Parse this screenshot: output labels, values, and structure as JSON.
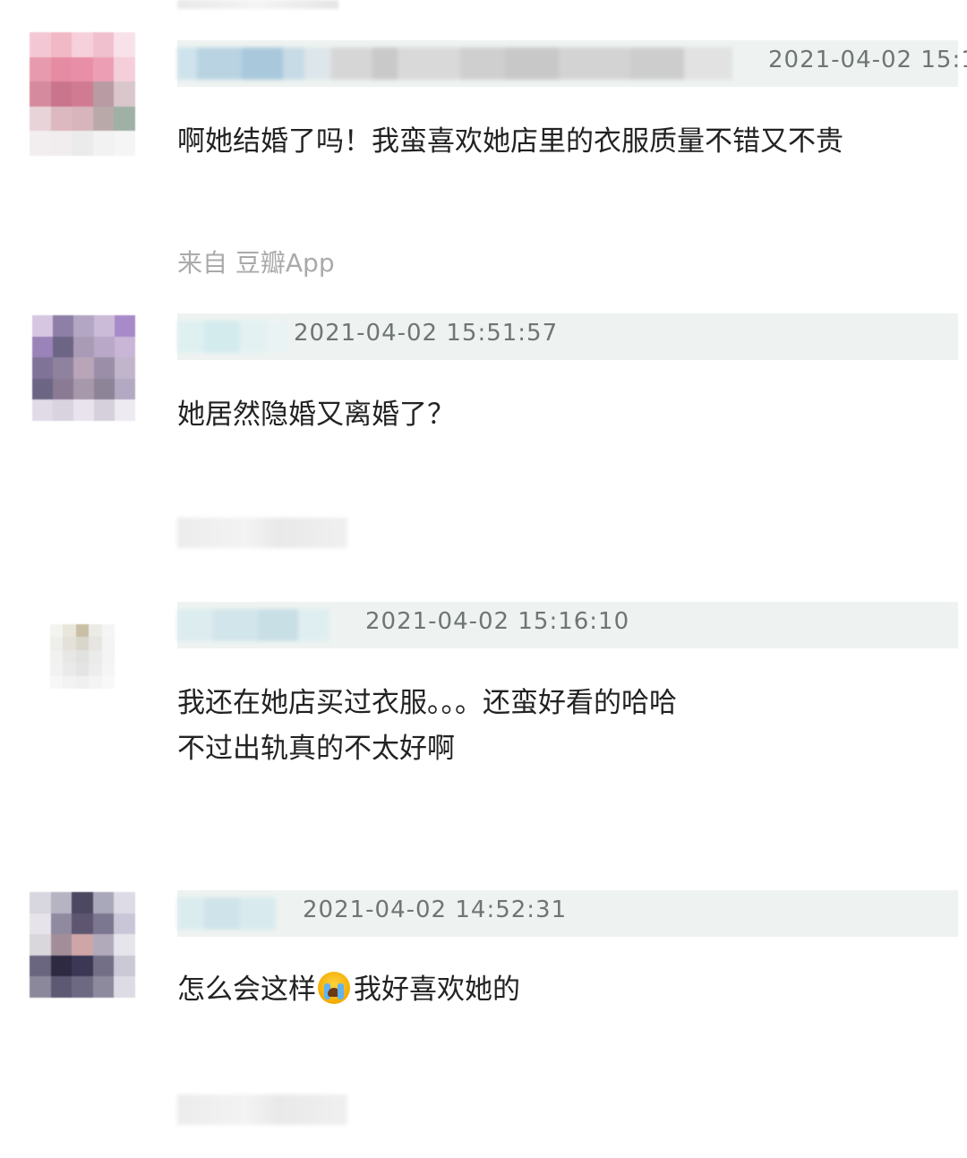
{
  "comments": [
    {
      "timestamp": "2021-04-02 15:1",
      "text": "啊她结婚了吗！我蛮喜欢她店里的衣服质量不错又不贵",
      "source": "来自 豆瓣App",
      "avatar_colors": [
        "#f3c8d4",
        "#f1b8c6",
        "#f6d0da",
        "#f0c0cf",
        "#f8e1e8",
        "#e79aae",
        "#e58ca3",
        "#e88ea7",
        "#ec9fb4",
        "#f4cfd9",
        "#d68a9d",
        "#c8758d",
        "#d17b93",
        "#b89ba3",
        "#d9c7cb",
        "#e7d3d8",
        "#dcb8c0",
        "#d8b4bc",
        "#b9a9a8",
        "#9fb1a5",
        "#f2eef0",
        "#f1ecee",
        "#ecebeb",
        "#f2f2f2",
        "#f5f5f5"
      ]
    },
    {
      "timestamp": "2021-04-02 15:51:57",
      "text": "她居然隐婚又离婚了？",
      "avatar_colors": [
        "#d6c6e2",
        "#8d7fa5",
        "#b3a6c4",
        "#cbbad8",
        "#a88ac9",
        "#9a83b8",
        "#6d6584",
        "#a99bb6",
        "#b9a8c7",
        "#c9b6d6",
        "#7f7398",
        "#8f829f",
        "#b8a6b8",
        "#9b8ea8",
        "#c1b5cc",
        "#6c6584",
        "#8b7a94",
        "#a798ab",
        "#8d8497",
        "#b3a9c2",
        "#e1dbe8",
        "#d9d3e0",
        "#e8e3ec",
        "#d5d0dc",
        "#eeeaf1"
      ]
    },
    {
      "timestamp": "2021-04-02 15:16:10",
      "text_lines": [
        "我还在她店买过衣服。。。还蛮好看的哈哈",
        "不过出轨真的不太好啊"
      ],
      "avatar_colors": [
        "#f3f3f0",
        "#e9e6dc",
        "#c8bfa4",
        "#ecebe6",
        "#f5f5f5",
        "#eeeeea",
        "#e3e1da",
        "#d9d6cc",
        "#e6e5e1",
        "#f4f4f4",
        "#f1f1ef",
        "#e7e7e5",
        "#e1e1df",
        "#ebebea",
        "#f4f4f4",
        "#f2f2f2",
        "#eaeaea",
        "#e4e4e4",
        "#ededed",
        "#f5f5f5",
        "#f7f7f7",
        "#f3f3f3",
        "#f0f0f0",
        "#f4f4f4",
        "#f8f8f8"
      ]
    },
    {
      "timestamp": "2021-04-02 14:52:31",
      "text_before_emoji": "怎么会这样",
      "emoji": "loudly-crying-face",
      "text_after_emoji": "我好喜欢她的",
      "avatar_colors": [
        "#d8d6de",
        "#b6b3c3",
        "#4d4862",
        "#a9a7ba",
        "#dcdbe6",
        "#e6e4ea",
        "#8f8aa0",
        "#5e5670",
        "#7c7790",
        "#c9c7d7",
        "#d9d6dc",
        "#a28e98",
        "#cfa6a8",
        "#b1aabb",
        "#e7e5ec",
        "#6a6680",
        "#2d2a42",
        "#3b3754",
        "#736f86",
        "#cbc9d5",
        "#8c889b",
        "#5d5973",
        "#6d6982",
        "#8e8a9d",
        "#dddbe3"
      ]
    }
  ],
  "colors": {
    "header_bg": "#eef3f1",
    "timestamp": "#6f7672",
    "text": "#222222",
    "source": "#a9aaa9"
  }
}
